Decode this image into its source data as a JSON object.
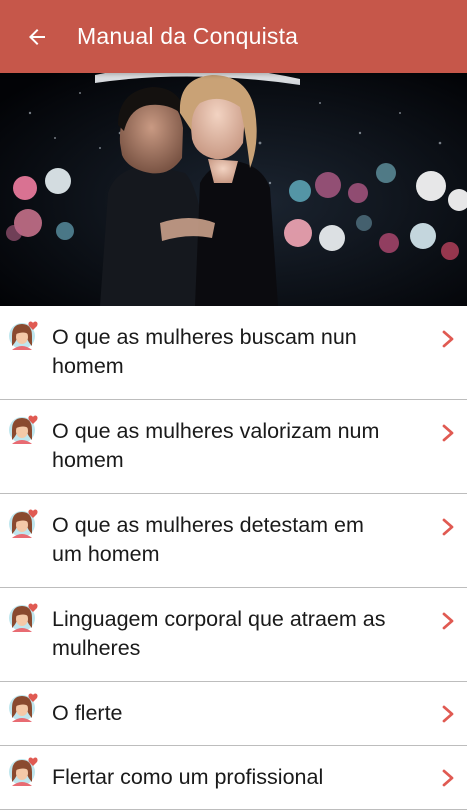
{
  "appbar": {
    "title": "Manual da Conquista",
    "back_icon": "arrow-back-icon",
    "background": "#c6574a"
  },
  "hero": {
    "image": "couple-in-rain-photo"
  },
  "menu": {
    "accent": "#e05a52",
    "items": [
      {
        "label": "O que as mulheres buscam nun homem",
        "icon": "woman-heart-avatar-icon"
      },
      {
        "label": "O que as mulheres valorizam num homem",
        "icon": "woman-heart-avatar-icon"
      },
      {
        "label": "O que as mulheres detestam em um homem",
        "icon": "woman-heart-avatar-icon"
      },
      {
        "label": "Linguagem corporal que atraem as mulheres",
        "icon": "woman-heart-avatar-icon"
      },
      {
        "label": "O flerte",
        "icon": "woman-heart-avatar-icon"
      },
      {
        "label": "Flertar como um profissional",
        "icon": "woman-heart-avatar-icon"
      }
    ]
  }
}
